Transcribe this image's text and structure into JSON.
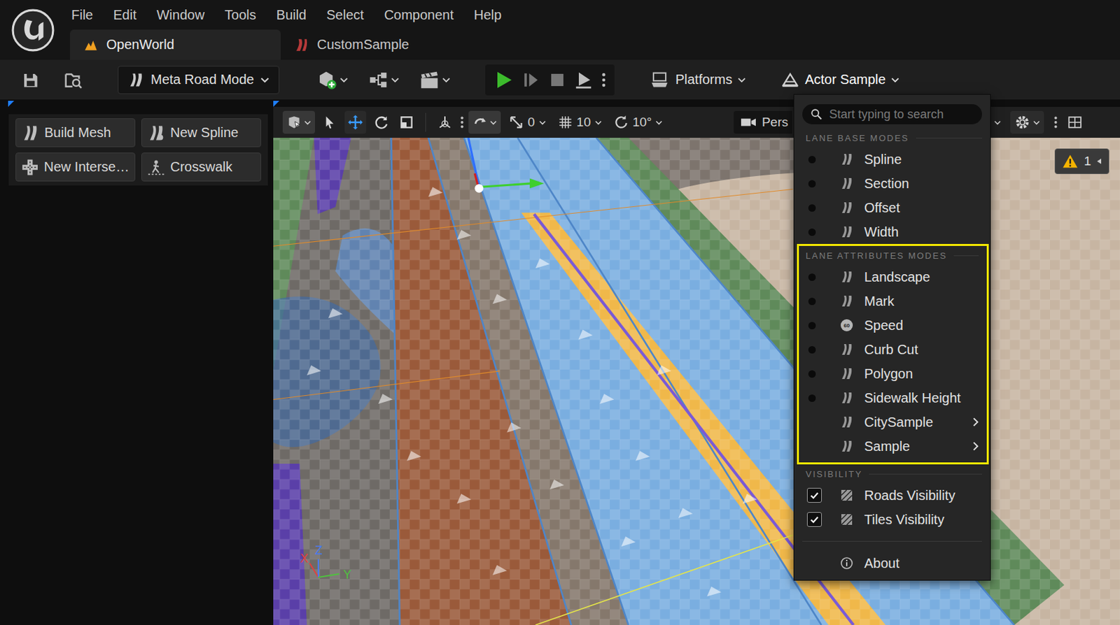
{
  "menubar": [
    "File",
    "Edit",
    "Window",
    "Tools",
    "Build",
    "Select",
    "Component",
    "Help"
  ],
  "tabs": [
    {
      "label": "OpenWorld",
      "selected": true
    },
    {
      "label": "CustomSample",
      "selected": false
    }
  ],
  "toolbar": {
    "mode_button": "Meta Road Mode",
    "platforms_button": "Platforms",
    "actor_menu_button": "Actor Sample",
    "actor_menu_open": true
  },
  "road_tools": [
    "Build Mesh",
    "New Spline",
    "New Interse…",
    "Crosswalk"
  ],
  "viewport_toolbar": {
    "transform_tools": [
      {
        "kind": "select",
        "selected": false
      },
      {
        "kind": "translate",
        "selected": true
      },
      {
        "kind": "rotate",
        "selected": false
      },
      {
        "kind": "scale",
        "selected": false
      }
    ],
    "translate_snap": "0",
    "grid_snap": "10",
    "rotate_snap": "10°",
    "camera": "Pers"
  },
  "warnings": {
    "count": "1"
  },
  "axes": [
    "X",
    "Z",
    "Y"
  ],
  "menu": {
    "search_placeholder": "Start typing to search",
    "sections": [
      {
        "title": "LANE BASE MODES",
        "highlighted": false,
        "items": [
          {
            "label": "Spline",
            "kind": "radio",
            "selected": false
          },
          {
            "label": "Section",
            "kind": "radio",
            "selected": false
          },
          {
            "label": "Offset",
            "kind": "radio",
            "selected": false
          },
          {
            "label": "Width",
            "kind": "radio",
            "selected": false
          }
        ]
      },
      {
        "title": "LANE ATTRIBUTES MODES",
        "highlighted": true,
        "items": [
          {
            "label": "Landscape",
            "kind": "radio",
            "selected": false
          },
          {
            "label": "Mark",
            "kind": "radio",
            "selected": false
          },
          {
            "label": "Speed",
            "kind": "radio",
            "selected": false,
            "icon_text": "60"
          },
          {
            "label": "Curb Cut",
            "kind": "radio",
            "selected": false
          },
          {
            "label": "Polygon",
            "kind": "radio",
            "selected": false
          },
          {
            "label": "Sidewalk Height",
            "kind": "radio",
            "selected": false
          },
          {
            "label": "CitySample",
            "kind": "submenu"
          },
          {
            "label": "Sample",
            "kind": "submenu"
          }
        ]
      },
      {
        "title": "VISIBILITY",
        "highlighted": false,
        "items": [
          {
            "label": "Roads Visibility",
            "kind": "check",
            "checked": true
          },
          {
            "label": "Tiles Visibility",
            "kind": "check",
            "checked": true
          }
        ]
      }
    ],
    "about": "About"
  }
}
